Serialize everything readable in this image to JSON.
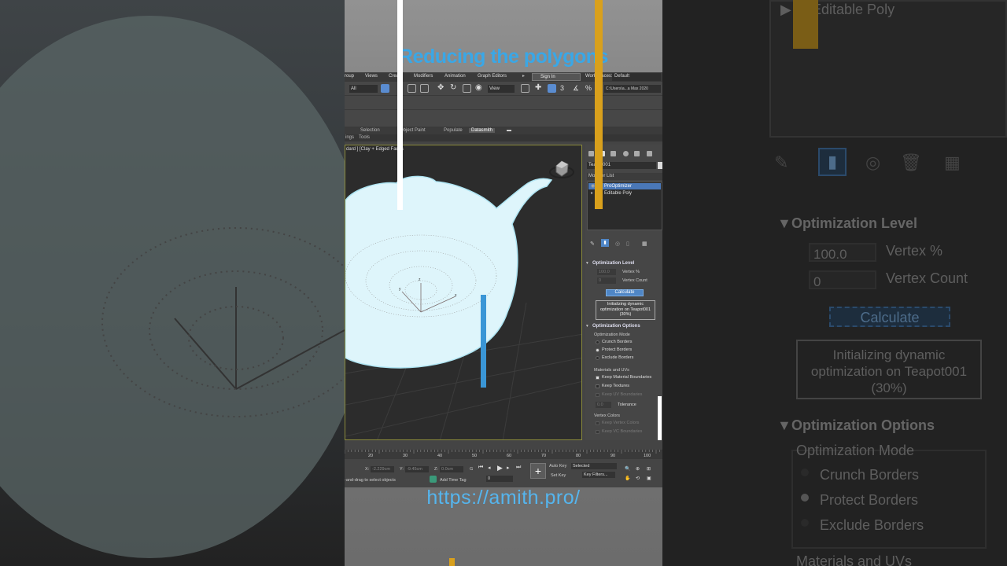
{
  "video": {
    "title": "Reducing the polygons",
    "url": "https://amith.pro/"
  },
  "menubar": {
    "items": [
      "roup",
      "Views",
      "Create",
      "Modifiers",
      "Animation",
      "Graph Editors"
    ],
    "sign_in": "Sign In",
    "workspaces_label": "Workspaces:",
    "workspace_value": "Default",
    "path_value": "C:\\Users\\a...a Max 2020"
  },
  "toolbar": {
    "selection_filter": "All",
    "ref_coord": "View"
  },
  "ribbon_tabs": {
    "tabs": [
      "Selection",
      "Object Paint",
      "Populate",
      "Datasmith"
    ],
    "active": "Datasmith",
    "sub": [
      "ings",
      "Tools"
    ]
  },
  "viewport": {
    "label": "dard ] [Clay + Edged Faces"
  },
  "command_panel": {
    "object_name": "Teapot001",
    "modifier_list_label": "Modifier List",
    "stack": [
      {
        "label": "ProOptimizer",
        "selected": true
      },
      {
        "label": "Editable Poly",
        "selected": false
      }
    ],
    "optimization_level": {
      "heading": "Optimization Level",
      "vertex_percent_value": "100.0",
      "vertex_percent_label": "Vertex %",
      "vertex_count_value": "0",
      "vertex_count_label": "Vertex Count",
      "calculate_label": "Calculate",
      "status_message": "Initializing dynamic optimization on Teapot001 (30%)"
    },
    "optimization_options": {
      "heading": "Optimization Options",
      "mode_label": "Optimization Mode",
      "modes": [
        {
          "label": "Crunch Borders",
          "selected": false
        },
        {
          "label": "Protect Borders",
          "selected": true
        },
        {
          "label": "Exclude Borders",
          "selected": false
        }
      ],
      "materials_label": "Materials and UVs",
      "keep_material_boundaries": "Keep Material Boundaries",
      "keep_textures": "Keep Textures",
      "keep_uv_boundaries": "Keep UV Boundaries",
      "tolerance_value": "0.0",
      "tolerance_label": "Tolerance",
      "vertex_colors_label": "Vertex Colors",
      "keep_vertex_colors": "Keep Vertex Colors",
      "keep_vc_boundaries": "Keep VC Boundaries"
    }
  },
  "timeline": {
    "ticks": [
      "20",
      "30",
      "40",
      "50",
      "60",
      "70",
      "80",
      "90",
      "100"
    ]
  },
  "status": {
    "x_label": "X:",
    "x_value": "-2.229cm",
    "y_label": "Y:",
    "y_value": "-9.45cm",
    "z_label": "Z:",
    "z_value": "0.0cm",
    "grid_label": "G",
    "prompt": "-and-drag to select objects",
    "add_time_tag": "Add Time Tag",
    "frame_value": "0",
    "auto_key": "Auto Key",
    "selected_value": "Selected",
    "set_key": "Set Key",
    "key_filters": "Key Filters..."
  },
  "right_zoom": {
    "stack_item": "Editable Poly",
    "level_heading": "Optimization Level",
    "vertex_percent_value": "100.0",
    "vertex_percent_label": "Vertex %",
    "vertex_count_value": "0",
    "vertex_count_label": "Vertex Count",
    "calculate_label": "Calculate",
    "status_message": "Initializing dynamic optimization on Teapot001 (30%)",
    "options_heading": "Optimization Options",
    "mode_label": "Optimization Mode",
    "modes": [
      "Crunch Borders",
      "Protect Borders",
      "Exclude Borders"
    ],
    "materials_label": "Materials and UVs"
  },
  "colors": {
    "accent": "#3aa7e6",
    "teapot_fill": "#def5fb",
    "bar_gold": "#d9a01c",
    "bar_blue": "#3a96d6",
    "selection_blue": "#4a78b8"
  }
}
